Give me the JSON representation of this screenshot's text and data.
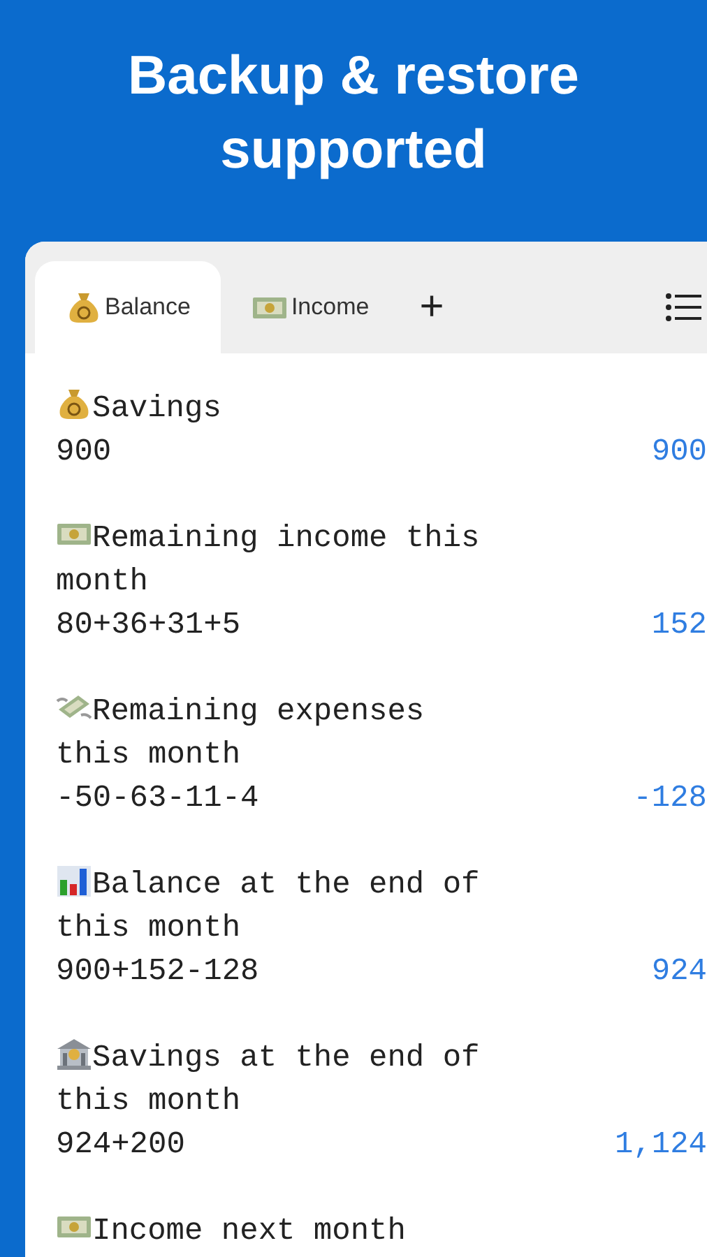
{
  "headline": "Backup & restore supported",
  "tabs": [
    {
      "label": "Balance",
      "selected": true
    },
    {
      "label": "Income",
      "selected": false
    }
  ],
  "add_tab": "+",
  "items": [
    {
      "title": "Savings",
      "formula": "900",
      "result": "900"
    },
    {
      "title": "Remaining income this month",
      "formula": "80+36+31+5",
      "result": "152"
    },
    {
      "title": "Remaining expenses this month",
      "formula": "-50-63-11-4",
      "result": "-128"
    },
    {
      "title": "Balance at the end of this month",
      "formula": "900+152-128",
      "result": "924"
    },
    {
      "title": "Savings at the end of this month",
      "formula": "924+200",
      "result": "1,124"
    },
    {
      "title": "Income next month"
    }
  ]
}
